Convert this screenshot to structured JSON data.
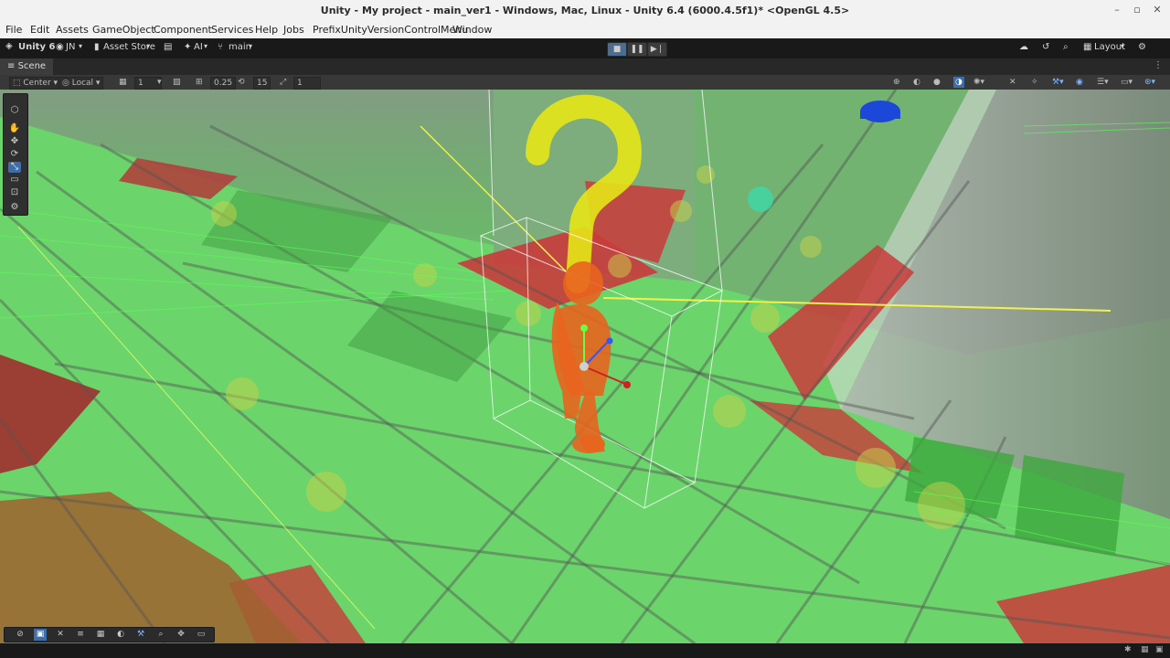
{
  "window": {
    "title": "Unity - My project - main_ver1 - Windows, Mac, Linux - Unity 6.4 (6000.4.5f1)* <OpenGL 4.5>",
    "controls": [
      "–",
      "▫",
      "✕"
    ]
  },
  "menu": {
    "items": [
      "File",
      "Edit",
      "Assets",
      "GameObject",
      "Component",
      "Services",
      "Help",
      "Jobs",
      "PrefixUnityVersionControlMenu",
      "Window"
    ]
  },
  "toolbar": {
    "unity_label": "Unity 6",
    "account_label": "JN",
    "asset_store_label": "Asset Store",
    "ai_label": "AI",
    "branch_label": "main",
    "layout_label": "Layout"
  },
  "tabs": {
    "scene_label": "Scene"
  },
  "scene_toolbar": {
    "pivot_label": "Center",
    "space_label": "Local",
    "grid_value": "1",
    "snap_value": "0.25",
    "angle_value": "15",
    "scale_value": "1"
  },
  "colors": {
    "floor_green": "#6fd86f",
    "tile_red": "#c93b3b",
    "character_orange": "#e8641e",
    "question_yellow": "#e6e617",
    "cap_blue": "#1b48d8",
    "accent_blue": "#3d6ea8"
  }
}
